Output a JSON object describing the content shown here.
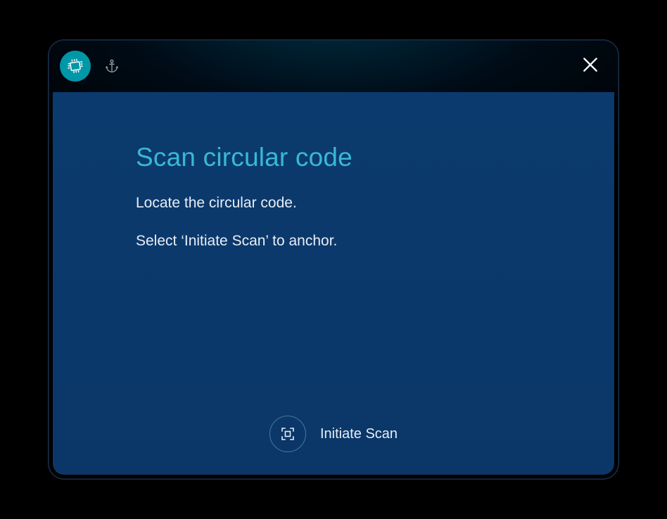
{
  "tabs": {
    "scan": {
      "name": "scan-tab",
      "active": true
    },
    "anchor": {
      "name": "anchor-tab",
      "active": false
    }
  },
  "content": {
    "heading": "Scan circular code",
    "line1": "Locate the circular code.",
    "line2": "Select ‘Initiate Scan’ to anchor."
  },
  "action": {
    "label": "Initiate Scan"
  }
}
